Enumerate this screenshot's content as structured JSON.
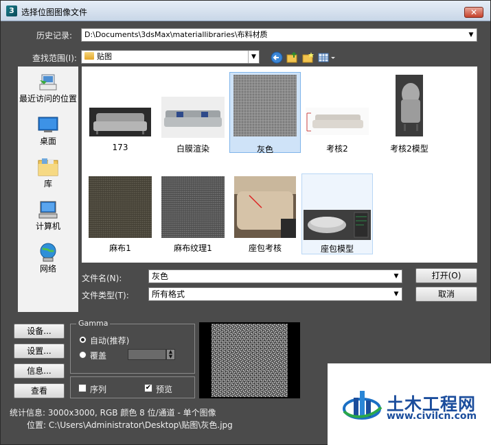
{
  "window": {
    "title": "选择位图图像文件",
    "app_icon": "3",
    "close_label": "✕"
  },
  "history": {
    "label": "历史记录:",
    "value": "D:\\Documents\\3dsMax\\materiallibraries\\布料材质"
  },
  "lookin": {
    "label": "查找范围(I):",
    "value": "贴图"
  },
  "places": [
    {
      "label": "最近访问的位置",
      "icon": "recent-places-icon"
    },
    {
      "label": "桌面",
      "icon": "desktop-icon"
    },
    {
      "label": "库",
      "icon": "libraries-icon"
    },
    {
      "label": "计算机",
      "icon": "computer-icon"
    },
    {
      "label": "网络",
      "icon": "network-icon"
    }
  ],
  "files": [
    {
      "name": "173"
    },
    {
      "name": "白膜渲染"
    },
    {
      "name": "灰色",
      "selected": true
    },
    {
      "name": "考核2"
    },
    {
      "name": "考核2模型"
    },
    {
      "name": "麻布1"
    },
    {
      "name": "麻布纹理1"
    },
    {
      "name": "座包考核"
    },
    {
      "name": "座包模型"
    }
  ],
  "filename": {
    "label": "文件名(N):",
    "value": "灰色"
  },
  "filetype": {
    "label": "文件类型(T):",
    "value": "所有格式"
  },
  "buttons": {
    "open": "打开(O)",
    "cancel": "取消"
  },
  "side_buttons": [
    "设备...",
    "设置...",
    "信息...",
    "查看"
  ],
  "gamma": {
    "title": "Gamma",
    "auto": "自动(推荐)",
    "override": "覆盖",
    "override_value": ""
  },
  "options": {
    "sequence": "序列",
    "preview": "预览",
    "preview_checked": "✔"
  },
  "stats": {
    "info": "统计信息: 3000x3000, RGB 颜色 8 位/通道 - 单个图像",
    "location": "位置: C:\\Users\\Administrator\\Desktop\\贴图\\灰色.jpg"
  },
  "watermark": {
    "title": "土木工程网",
    "url": "www.civilcn.com"
  }
}
